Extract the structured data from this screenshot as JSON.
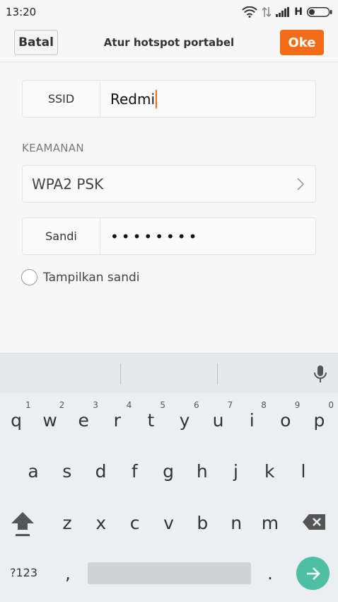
{
  "status_bar": {
    "time": "13:20",
    "network_type": "H",
    "icons": [
      "wifi-icon",
      "data-arrows-icon",
      "signal-icon",
      "battery-icon"
    ]
  },
  "header": {
    "cancel_label": "Batal",
    "title": "Atur hotspot portabel",
    "ok_label": "Oke"
  },
  "form": {
    "ssid_label": "SSID",
    "ssid_value": "Redmi",
    "security_section": "KEAMANAN",
    "security_value": "WPA2 PSK",
    "password_label": "Sandi",
    "password_masked": "••••••••",
    "show_password_label": "Tampilkan sandi",
    "show_password_checked": false
  },
  "keyboard": {
    "row1": [
      "q",
      "w",
      "e",
      "r",
      "t",
      "y",
      "u",
      "i",
      "o",
      "p"
    ],
    "row1_hints": [
      "1",
      "2",
      "3",
      "4",
      "5",
      "6",
      "7",
      "8",
      "9",
      "0"
    ],
    "row2": [
      "a",
      "s",
      "d",
      "f",
      "g",
      "h",
      "j",
      "k",
      "l"
    ],
    "row3": [
      "z",
      "x",
      "c",
      "v",
      "b",
      "n",
      "m"
    ],
    "symbols_label": "?123",
    "comma": ",",
    "period": "."
  },
  "colors": {
    "accent": "#f36d18",
    "enter": "#4cbfa5"
  }
}
